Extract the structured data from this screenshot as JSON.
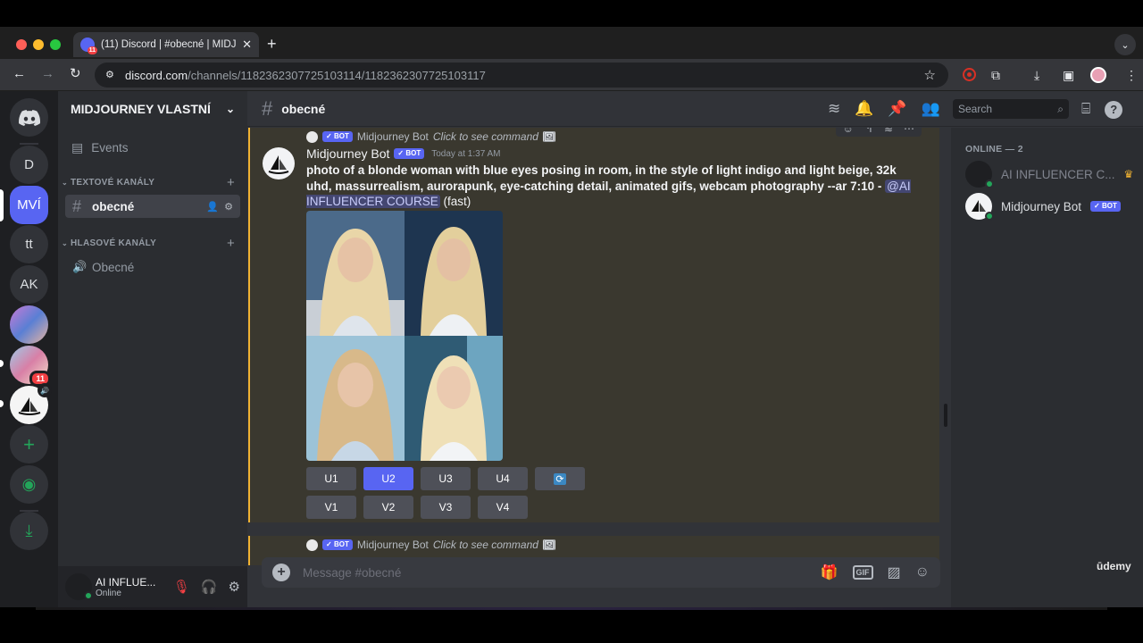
{
  "browser": {
    "tab_title": "(11) Discord | #obecné | MIDJ",
    "tab_badge": "11",
    "url_domain": "discord.com",
    "url_path": "/channels/1182362307725103114/1182362307725103117"
  },
  "guilds": {
    "items": [
      "D",
      "MVÍ",
      "tt",
      "AK"
    ],
    "badge": "11"
  },
  "server": {
    "name": "MIDJOURNEY VLASTNÍ",
    "events_label": "Events",
    "text_category": "TEXTOVÉ KANÁLY",
    "text_channel": "obecné",
    "voice_category": "HLASOVÉ KANÁLY",
    "voice_channel": "Obecné"
  },
  "user": {
    "name": "AI INFLUE...",
    "status": "Online"
  },
  "header": {
    "channel": "obecné",
    "search_placeholder": "Search"
  },
  "message": {
    "ref_author": "Midjourney Bot",
    "ref_text": "Click to see command",
    "author": "Midjourney Bot",
    "bot_tag": "BOT",
    "timestamp": "Today at 1:37 AM",
    "prompt": "photo of a blonde woman with blue eyes posing in room, in the style of light indigo and light beige, 32k uhd, massurrealism, aurorapunk, eye-catching detail, animated gifs, webcam photography --ar 7:10 - ",
    "mention": "@AI INFLUENCER COURSE",
    "speed": "(fast)",
    "upscale_buttons": [
      "U1",
      "U2",
      "U3",
      "U4"
    ],
    "variation_buttons": [
      "V1",
      "V2",
      "V3",
      "V4"
    ],
    "reroll_icon": "refresh-icon"
  },
  "next_message": {
    "ref_author": "Midjourney Bot",
    "ref_text": "Click to see command"
  },
  "composer": {
    "placeholder": "Message #obecné"
  },
  "members": {
    "heading": "ONLINE — 2",
    "items": [
      "AI INFLUENCER C...",
      "Midjourney Bot"
    ]
  },
  "watermark": "ūdemy",
  "colors": {
    "blurple": "#5865f2",
    "online": "#23a55a",
    "highlight_border": "#f0b232"
  }
}
